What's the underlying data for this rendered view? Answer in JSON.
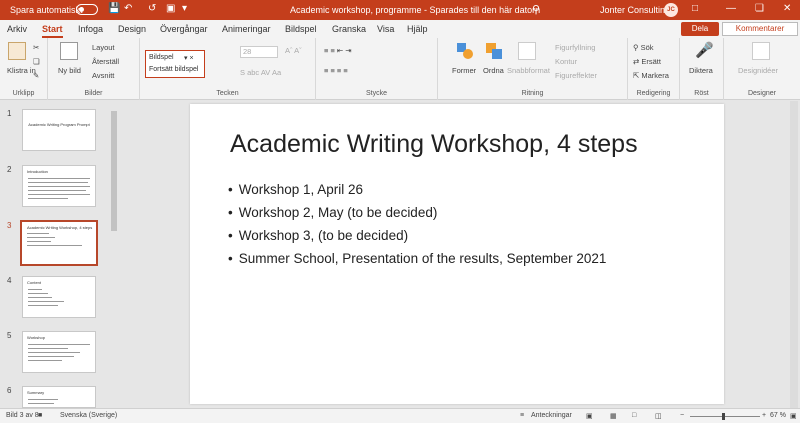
{
  "titlebar": {
    "autosave_label": "Spara automatiskt",
    "doc_title": "Academic workshop, programme  -  Sparades till den här datorn",
    "account": "Jonter Consulting",
    "avatar": "JC",
    "icons": [
      "save-icon",
      "undo-icon",
      "redo-icon",
      "start-from-beginning-icon",
      "customize-qat-icon",
      "search-icon",
      "minimize-icon",
      "restore-icon",
      "close-icon"
    ]
  },
  "tabs": [
    "Arkiv",
    "Start",
    "Infoga",
    "Design",
    "Övergångar",
    "Animeringar",
    "Bildspel",
    "Granska",
    "Visa",
    "Hjälp"
  ],
  "share_label": "Dela",
  "comments_label": "Kommentarer",
  "ribbon": {
    "clipboard": {
      "paste": "Klistra in",
      "label": "Urklipp"
    },
    "slides": {
      "new_slide": "Ny bild",
      "layout": "Layout",
      "reset": "Återställ",
      "section": "Avsnitt",
      "label": "Bilder"
    },
    "font": {
      "label": "Tecken",
      "font_size": "28"
    },
    "slideshow_box": {
      "title": "Bildspel",
      "resume": "Fortsätt bildspel"
    },
    "paragraph": {
      "label": "Stycke"
    },
    "drawing": {
      "shapes": "Former",
      "arrange": "Ordna",
      "quick_styles": "Snabbformat",
      "fill": "Figurfyllning",
      "outline": "Kontur",
      "effects": "Figureffekter",
      "label": "Ritning"
    },
    "editing": {
      "find": "Sök",
      "replace": "Ersätt",
      "select": "Markera",
      "label": "Redigering"
    },
    "voice": {
      "dictate": "Diktera",
      "label": "Röst"
    },
    "designer": {
      "ideas": "Designidéer",
      "label": "Designer"
    }
  },
  "thumbnails": [
    {
      "num": "1",
      "title": "Academic Writing Program Prompt"
    },
    {
      "num": "2",
      "title": "Introduction"
    },
    {
      "num": "3",
      "title": "Academic Writing Workshop, 4 steps"
    },
    {
      "num": "4",
      "title": "Content"
    },
    {
      "num": "5",
      "title": "Workshop"
    },
    {
      "num": "6",
      "title": "Summary"
    }
  ],
  "slide": {
    "title": "Academic Writing Workshop, 4 steps",
    "bullets": [
      "Workshop 1, April 26",
      "Workshop 2, May (to be decided)",
      "Workshop 3, (to be decided)",
      "Summer School, Presentation of the results, September 2021"
    ]
  },
  "statusbar": {
    "slide_info": "Bild 3 av 8",
    "language": "Svenska (Sverige)",
    "notes": "Anteckningar",
    "zoom": "67 %"
  }
}
